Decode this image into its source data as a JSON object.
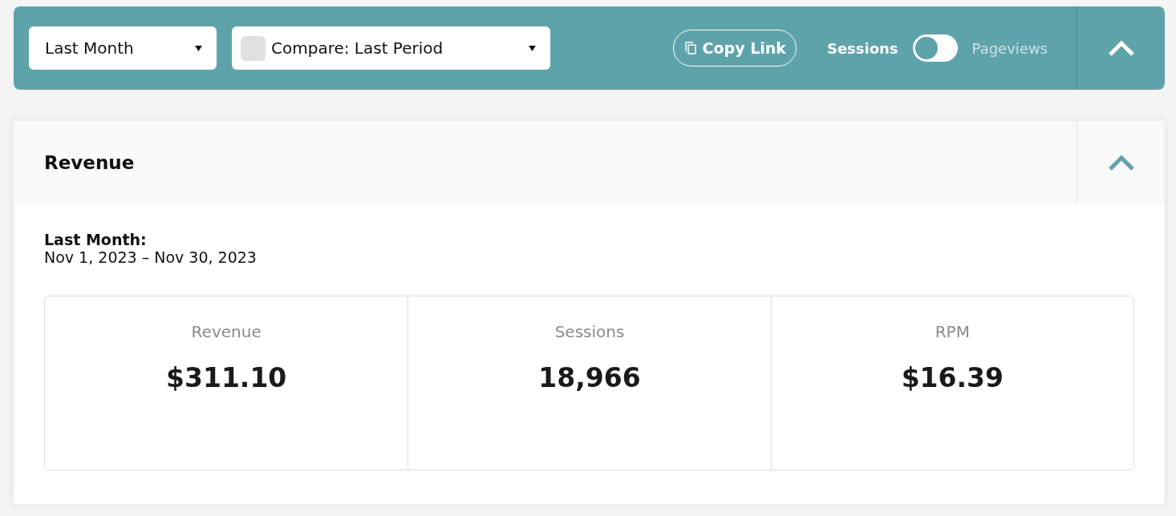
{
  "toolbar": {
    "date_range": {
      "value": "Last Month"
    },
    "compare": {
      "checked": false,
      "value": "Compare: Last Period"
    },
    "copy_link": {
      "label": "Copy Link"
    },
    "metric_toggle": {
      "left_label": "Sessions",
      "right_label": "Pageviews",
      "on": false
    },
    "collapse": {
      "expanded": true
    }
  },
  "panel": {
    "title": "Revenue",
    "expanded": true,
    "period_label": "Last Month:",
    "period_dates": "Nov 1, 2023 – Nov 30, 2023",
    "metrics": [
      {
        "label": "Revenue",
        "value": "$311.10"
      },
      {
        "label": "Sessions",
        "value": "18,966"
      },
      {
        "label": "RPM",
        "value": "$16.39"
      }
    ]
  }
}
